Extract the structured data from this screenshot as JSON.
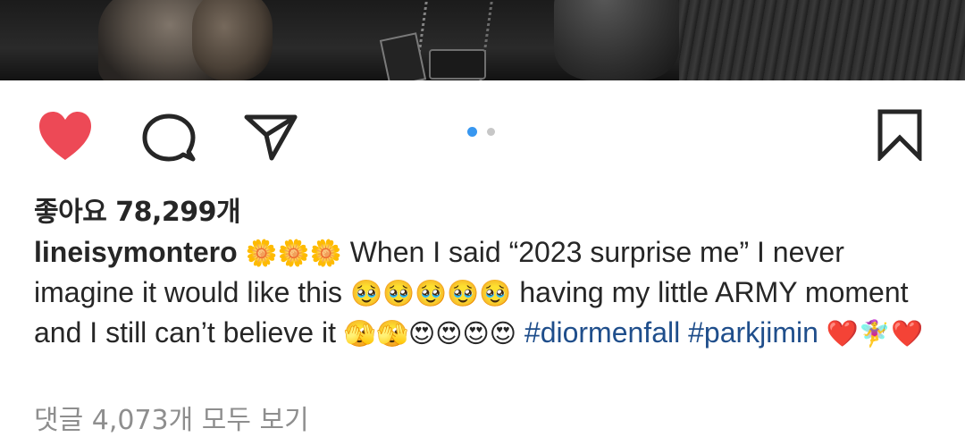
{
  "post": {
    "likes_label": "좋아요 78,299개",
    "username": "lineisymontero",
    "caption_segments": {
      "flowers": "🌼🌼🌼",
      "text1": " When I said “2023 surprise me” I never imagine it would like this ",
      "pleading": "🥹🥹🥹🥹🥹",
      "text2": " having my little ARMY moment and I still can’t believe it ",
      "faces": "🫣🫣😍😍😍😍",
      "space": " ",
      "tag1": "#diormenfall",
      "tag2": "#parkjimin",
      "ending": "❤️🧚‍♀️❤️"
    },
    "view_comments": "댓글 4,073개 모두 보기"
  },
  "actions": {
    "like_icon": "heart-filled-icon",
    "comment_icon": "speech-bubble-icon",
    "share_icon": "paper-plane-icon",
    "save_icon": "bookmark-icon"
  },
  "carousel": {
    "total": 2,
    "active_index": 0
  },
  "colors": {
    "like": "#ed4956",
    "link": "#1f4e8b",
    "muted": "#8e8e8e",
    "active_dot": "#3897f0",
    "inactive_dot": "#c7c7c7"
  }
}
